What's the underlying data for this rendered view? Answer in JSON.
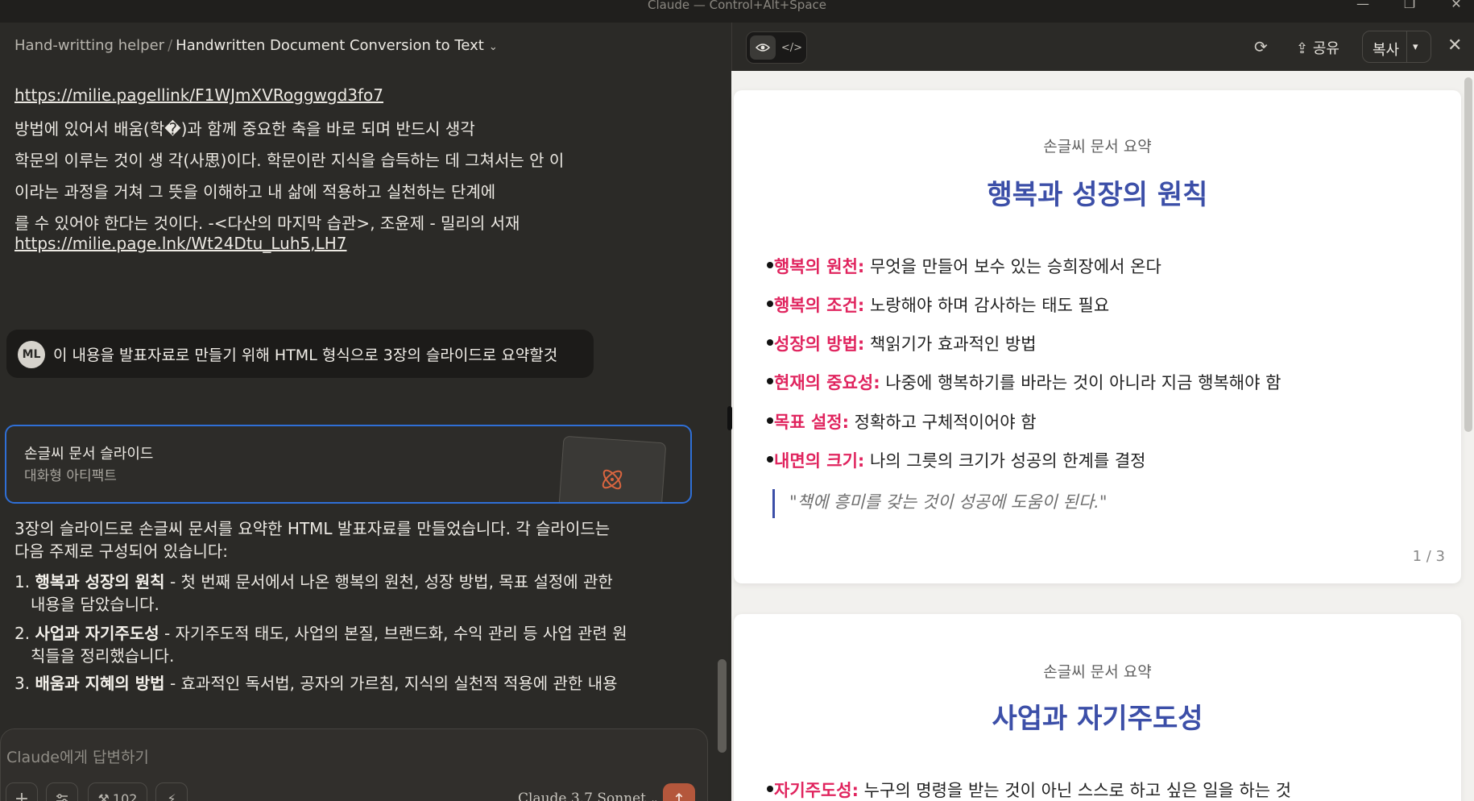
{
  "window": {
    "title": "Claude — Control+Alt+Space",
    "controls": [
      "minimize",
      "restore",
      "close"
    ]
  },
  "breadcrumb": {
    "project": "Hand-writting helper",
    "separator": "/",
    "chat": "Handwritten Document Conversion to Text"
  },
  "document_text": {
    "link1": "https://milie.pagellink/F1WJmXVRoggwgd3fo7",
    "line1": "방법에 있어서 배움(학�)과 함께 중요한 축을 바로 되며 반드시 생각",
    "line2": "학문의 이루는 것이 생 각(사思)이다. 학문이란 지식을 습득하는 데 그쳐서는 안 이",
    "line3": "이라는 과정을 거쳐 그 뜻을 이해하고 내 삶에 적용하고 실천하는 단계에",
    "line4": "를 수 있어야 한다는 것이다. -<다산의 마지막 습관>, 조윤제 - 밀리의 서재",
    "link2": "https://milie.page.lnk/Wt24Dtu_Luh5,LH7"
  },
  "user_message": {
    "avatar": "ML",
    "text": "이 내용을 발표자료로 만들기 위해 HTML 형식으로 3장의 슬라이드로 요약할것"
  },
  "artifact_card": {
    "title": "손글씨 문서 슬라이드",
    "subtitle": "대화형 아티팩트",
    "icon": "atom-icon"
  },
  "response": {
    "intro1": "3장의 슬라이드로 손글씨 문서를 요약한 HTML 발표자료를 만들었습니다. 각 슬라이드는",
    "intro2": "다음 주제로 구성되어 있습니다:",
    "items": [
      {
        "num": "1.",
        "title": "행복과 성장의 원칙",
        "text": " - 첫 번째 문서에서 나온 행복의 원천, 성장 방법, 목표 설정에 관한",
        "text2": "내용을 담았습니다."
      },
      {
        "num": "2.",
        "title": "사업과 자기주도성",
        "text": " - 자기주도적 태도, 사업의 본질, 브랜드화, 수익 관리 등 사업 관련 원",
        "text2": "칙들을 정리했습니다."
      },
      {
        "num": "3.",
        "title": "배움과 지혜의 방법",
        "text": " - 효과적인 독서법, 공자의 가르침, 지식의 실천적 적용에 관한 내용"
      }
    ]
  },
  "composer": {
    "placeholder": "Claude에게 답변하기",
    "tools_count": "102",
    "model": "Claude 3.7 Sonnet"
  },
  "artifact_toolbar": {
    "share_label": "공유",
    "copy_label": "복사"
  },
  "slides": [
    {
      "kicker": "손글씨 문서 요약",
      "title": "행복과 성장의 원칙",
      "bullets": [
        {
          "key": "행복의 원천:",
          "text": " 무엇을 만들어 보수 있는 승희장에서 온다"
        },
        {
          "key": "행복의 조건:",
          "text": " 노랑해야 하며 감사하는 태도 필요"
        },
        {
          "key": "성장의 방법:",
          "text": " 책읽기가 효과적인 방법"
        },
        {
          "key": "현재의 중요성:",
          "text": " 나중에 행복하기를 바라는 것이 아니라 지금 행복해야 함"
        },
        {
          "key": "목표 설정:",
          "text": " 정확하고 구체적이어야 함"
        },
        {
          "key": "내면의 크기:",
          "text": " 나의 그릇의 크기가 성공의 한계를 결정"
        }
      ],
      "quote": "\"책에 흥미를 갖는 것이 성공에 도움이 된다.\"",
      "page": "1 / 3"
    },
    {
      "kicker": "손글씨 문서 요약",
      "title": "사업과 자기주도성",
      "bullets": [
        {
          "key": "자기주도성:",
          "text": " 누구의 명령을 받는 것이 아닌 스스로 하고 싶은 일을 하는 것"
        }
      ]
    }
  ]
}
